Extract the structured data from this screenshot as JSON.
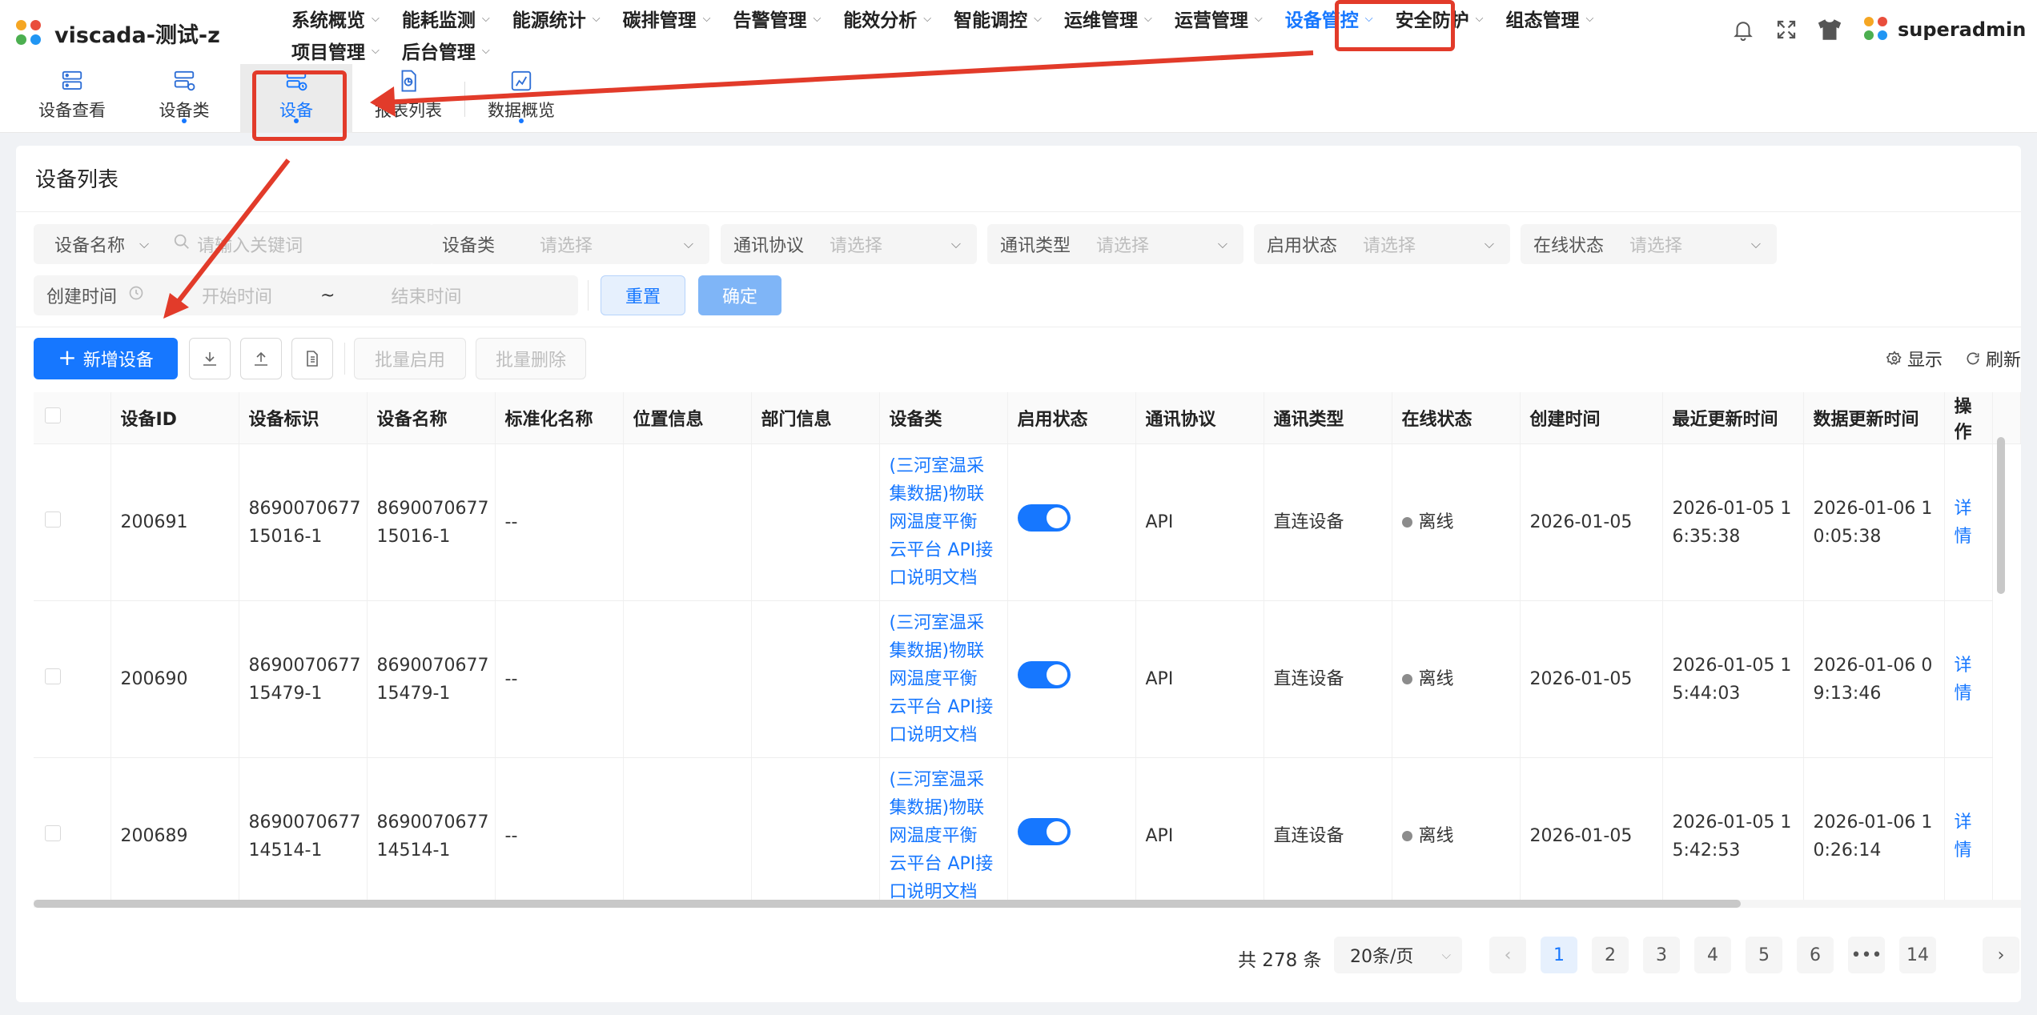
{
  "app": {
    "title": "viscada-测试-z"
  },
  "nav": {
    "row1": [
      "系统概览",
      "能耗监测",
      "能源统计",
      "碳排管理",
      "告警管理",
      "能效分析",
      "智能调控",
      "运维管理",
      "运营管理",
      "设备管控",
      "安全防护",
      "组态管理"
    ],
    "row2": [
      "项目管理",
      "后台管理"
    ],
    "active": "设备管控"
  },
  "user": {
    "name": "superadmin"
  },
  "subtabs": [
    "设备查看",
    "设备类",
    "设备",
    "报表列表",
    "数据概览"
  ],
  "card": {
    "title": "设备列表"
  },
  "filters": {
    "device_name": {
      "label": "设备名称",
      "placeholder": "请输入关键词"
    },
    "device_class": {
      "label": "设备类",
      "placeholder": "请选择"
    },
    "protocol": {
      "label": "通讯协议",
      "placeholder": "请选择"
    },
    "comm_type": {
      "label": "通讯类型",
      "placeholder": "请选择"
    },
    "enable_status": {
      "label": "启用状态",
      "placeholder": "请选择"
    },
    "online_status": {
      "label": "在线状态",
      "placeholder": "请选择"
    },
    "created": {
      "label": "创建时间",
      "start": "开始时间",
      "sep": "~",
      "end": "结束时间"
    },
    "reset": "重置",
    "confirm": "确定"
  },
  "toolbar": {
    "add": "新增设备",
    "batch_enable": "批量启用",
    "batch_delete": "批量删除",
    "display": "显示",
    "refresh": "刷新"
  },
  "table": {
    "columns": [
      "设备ID",
      "设备标识",
      "设备名称",
      "标准化名称",
      "位置信息",
      "部门信息",
      "设备类",
      "启用状态",
      "通讯协议",
      "通讯类型",
      "在线状态",
      "创建时间",
      "最近更新时间",
      "数据更新时间",
      "操作"
    ],
    "rows": [
      {
        "id": "200691",
        "ident1": "8690070677",
        "ident2": "15016-1",
        "name1": "8690070677",
        "name2": "15016-1",
        "std": "--",
        "loc": "",
        "dept": "",
        "cls": [
          "(三河室温采",
          "集数据)物联",
          "网温度平衡",
          "云平台 API接",
          "口说明文档"
        ],
        "protocol": "API",
        "ctype": "直连设备",
        "online": "离线",
        "created": "2026-01-05",
        "upd1": "2026-01-05 1",
        "upd2": "6:35:38",
        "dupd1": "2026-01-06 1",
        "dupd2": "0:05:38",
        "action": "详情"
      },
      {
        "id": "200690",
        "ident1": "8690070677",
        "ident2": "15479-1",
        "name1": "8690070677",
        "name2": "15479-1",
        "std": "--",
        "loc": "",
        "dept": "",
        "cls": [
          "(三河室温采",
          "集数据)物联",
          "网温度平衡",
          "云平台 API接",
          "口说明文档"
        ],
        "protocol": "API",
        "ctype": "直连设备",
        "online": "离线",
        "created": "2026-01-05",
        "upd1": "2026-01-05 1",
        "upd2": "5:44:03",
        "dupd1": "2026-01-06 0",
        "dupd2": "9:13:46",
        "action": "详情"
      },
      {
        "id": "200689",
        "ident1": "8690070677",
        "ident2": "14514-1",
        "name1": "8690070677",
        "name2": "14514-1",
        "std": "--",
        "loc": "",
        "dept": "",
        "cls": [
          "(三河室温采",
          "集数据)物联",
          "网温度平衡",
          "云平台 API接",
          "口说明文档"
        ],
        "protocol": "API",
        "ctype": "直连设备",
        "online": "离线",
        "created": "2026-01-05",
        "upd1": "2026-01-05 1",
        "upd2": "5:42:53",
        "dupd1": "2026-01-06 1",
        "dupd2": "0:26:14",
        "action": "详情"
      }
    ]
  },
  "pagination": {
    "total": "共 278 条",
    "page_size": "20条/页",
    "pages": [
      "1",
      "2",
      "3",
      "4",
      "5",
      "6",
      "•••",
      "14"
    ],
    "current": "1"
  },
  "colors": {
    "primary": "#1677ff",
    "annotation": "#e23b2a",
    "offline": "#8c8c8c"
  }
}
